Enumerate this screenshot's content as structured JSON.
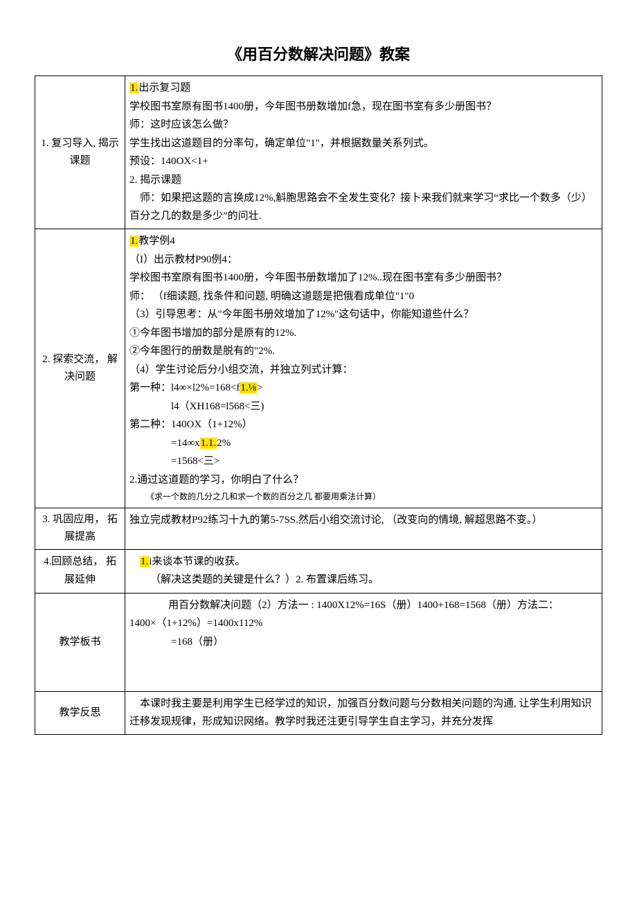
{
  "title": "《用百分数解决问题》教案",
  "rows": [
    {
      "label": "1. 复习导入, 揭示课题",
      "lines": [
        {
          "cls": "",
          "pre_hl": "1.",
          "text": "出示复习题"
        },
        {
          "cls": "",
          "text": "学校图书室原有图书1400册，今年图书册数增加f急，现在图书室有多少册图书？"
        },
        {
          "cls": "",
          "text": "师：这时应该怎么做？"
        },
        {
          "cls": "",
          "text": "学生找出这道题目的分率句，确定单位\"1\"，并根据数量关系列式。"
        },
        {
          "cls": "",
          "text": "预设：140OX<1+"
        },
        {
          "cls": "",
          "text": "2. 揭示课题"
        },
        {
          "cls": "indent1",
          "text": "师：如果把这题的言换成12%,斛胞思路会不全发生变化？接卜来我们就来学习“求比一个数多（少）百分之几的数是多少”的问壮."
        }
      ]
    },
    {
      "label": "2. 探索交流， 解决问题",
      "lines": [
        {
          "cls": "",
          "pre_hl": "1.",
          "text": "教学例4"
        },
        {
          "cls": "",
          "text": "（I）出示教材P90例4："
        },
        {
          "cls": "",
          "text": "学校图书室原有图书1400册，今年图书册数增加了12%..现在图书室有多少册图书？"
        },
        {
          "cls": "",
          "text": "师：  （f细读题, 找条件和问题, 明确这道题是把俄看成单位\"1\"0"
        },
        {
          "cls": "",
          "text": "（3）引导思考：从\"今年图书册效增加了12%\"这句话中，你能知道些什么？"
        },
        {
          "cls": "",
          "text": "①今年图书增加的部分是原有的12%."
        },
        {
          "cls": "",
          "text": "②今年图行的册数是脱有的\"2%."
        },
        {
          "cls": "",
          "text": "（4）学生讨论后分小组交流，并独立列式计算："
        },
        {
          "cls": "",
          "text": "第一种：l4∞×l2%=168<f",
          "post_hl": "1.⅛",
          "after": ">"
        },
        {
          "cls": "indent3",
          "text": "l4（XH168=l568<三)"
        },
        {
          "cls": "",
          "text": "第二种：140OX（1+12%）"
        },
        {
          "cls": "indent3",
          "text": "=14∞x",
          "post_hl": "1.1.",
          "after": "2%"
        },
        {
          "cls": "indent3",
          "text": "=1568<三>"
        },
        {
          "cls": "",
          "text": "2.通过这道题的学习，你明白了什么？"
        },
        {
          "cls": "indent2 small",
          "text": "《求一个数的几分之几和求一个数的百分之几  都要用乘法计算）"
        }
      ]
    },
    {
      "label": "3. 巩固应用， 拓展提高",
      "lines": [
        {
          "cls": "",
          "text": "独立完成教材P92练习十九的第5-7SS.然后小组交流讨论, （改变向的情境, 解超思路不变。）"
        }
      ]
    },
    {
      "label": "4.回顾总结， 拓展延伸",
      "lines": [
        {
          "cls": "indent1",
          "pre_hl": "1.",
          "text": "i来谈本节课的收获。"
        },
        {
          "cls": "indent2",
          "text": "（解决这类题的关键是什么？）2. 布置课后练习。"
        }
      ]
    },
    {
      "label": "教学板书",
      "lines": [
        {
          "cls": "",
          "style": "text-align:center;",
          "text": "用百分数解决问题（2）方法一 : 1400X12%=16S（册）1400+168=1568（册）方法二："
        },
        {
          "cls": "",
          "text": "1400×（1+12%）=1400x112%"
        },
        {
          "cls": "indent3",
          "text": "=168（册）"
        },
        {
          "cls": "",
          "text": " "
        },
        {
          "cls": "",
          "text": " "
        }
      ]
    },
    {
      "label": "教学反思",
      "lines": [
        {
          "cls": "indent1",
          "text": "本课时我主要是利用学生已经学过的知识，加强百分数问题与分数相关问题的沟通, 让学生利用知识迁移发现规律，形成知识网络。教学时我还注更引导学生自主学习，并充分发挥"
        }
      ]
    }
  ]
}
